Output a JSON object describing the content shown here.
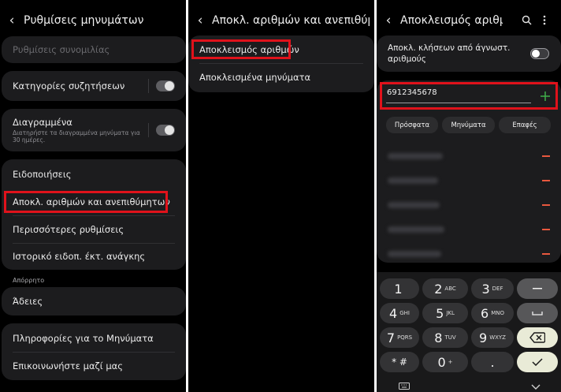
{
  "panel1": {
    "title": "Ρυθμίσεις μηνυμάτων",
    "conversation_settings": "Ρυθμίσεις συνομιλίας",
    "chat_categories": "Κατηγορίες συζητήσεων",
    "deleted": "Διαγραμμένα",
    "deleted_sub": "Διατηρήστε τα διαγραμμένα μηνύματα για 30 ημέρες.",
    "notifications": "Ειδοποιήσεις",
    "block_numbers_spam": "Αποκλ. αριθμών και ανεπιθύμητων",
    "more_settings": "Περισσότερες ρυθμίσεις",
    "emergency_history": "Ιστορικό ειδοπ. έκτ. ανάγκης",
    "privacy_header": "Απόρρητο",
    "permissions": "Άδειες",
    "about_messages": "Πληροφορίες για το Μηνύματα",
    "contact_us": "Επικοινωνήστε μαζί μας"
  },
  "panel2": {
    "title": "Αποκλ. αριθμών και ανεπιθύμητ...",
    "block_numbers": "Αποκλεισμός αριθμών",
    "blocked_messages": "Αποκλεισμένα μηνύματα"
  },
  "panel3": {
    "title": "Αποκλεισμός αριθμ...",
    "block_unknown": "Αποκλ. κλήσεων από άγνωστ. αριθμούς",
    "number_value": "6912345678",
    "chips": [
      "Πρόσφατα",
      "Μηνύματα",
      "Επαφές"
    ],
    "keypad": [
      {
        "digit": "1",
        "letters": ""
      },
      {
        "digit": "2",
        "letters": "ABC"
      },
      {
        "digit": "3",
        "letters": "DEF"
      },
      {
        "digit": "4",
        "letters": "GHI"
      },
      {
        "digit": "5",
        "letters": "JKL"
      },
      {
        "digit": "6",
        "letters": "MNO"
      },
      {
        "digit": "7",
        "letters": "PQRS"
      },
      {
        "digit": "8",
        "letters": "TUV"
      },
      {
        "digit": "9",
        "letters": "WXYZ"
      },
      {
        "digit": "* #",
        "letters": ""
      },
      {
        "digit": "0",
        "letters": "+"
      },
      {
        "digit": ".",
        "letters": ""
      }
    ]
  },
  "colors": {
    "background": "#000000",
    "card": "#1c1c1e",
    "highlight": "#e0121b",
    "add_green": "#3fae49",
    "remove_red": "#e8583e"
  },
  "icons": [
    "back-icon",
    "search-icon",
    "more-icon",
    "plus-icon",
    "minus-icon",
    "backspace-icon",
    "check-icon",
    "keyboard-icon",
    "chevron-down-icon"
  ]
}
